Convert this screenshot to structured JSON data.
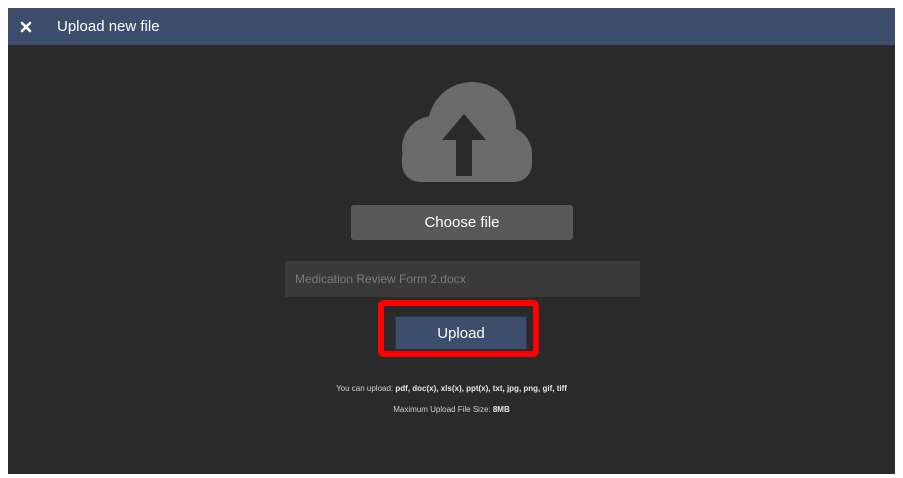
{
  "dialog": {
    "title": "Upload new file",
    "close_icon": "close-icon"
  },
  "upload_icon": "cloud-upload-icon",
  "choose_file_label": "Choose file",
  "file_field": {
    "value": "",
    "placeholder": "Medication Review Form 2.docx"
  },
  "upload_label": "Upload",
  "info": {
    "formats_prefix": "You can upload:",
    "formats": "pdf, doc(x), xls(x), ppt(x), txt, jpg, png, gif, tiff",
    "max_size_prefix": "Maximum Upload File Size:",
    "max_size": "8MB"
  },
  "colors": {
    "header": "#3c4e6b",
    "background": "#2a2a2a",
    "highlight": "#ff0000"
  }
}
